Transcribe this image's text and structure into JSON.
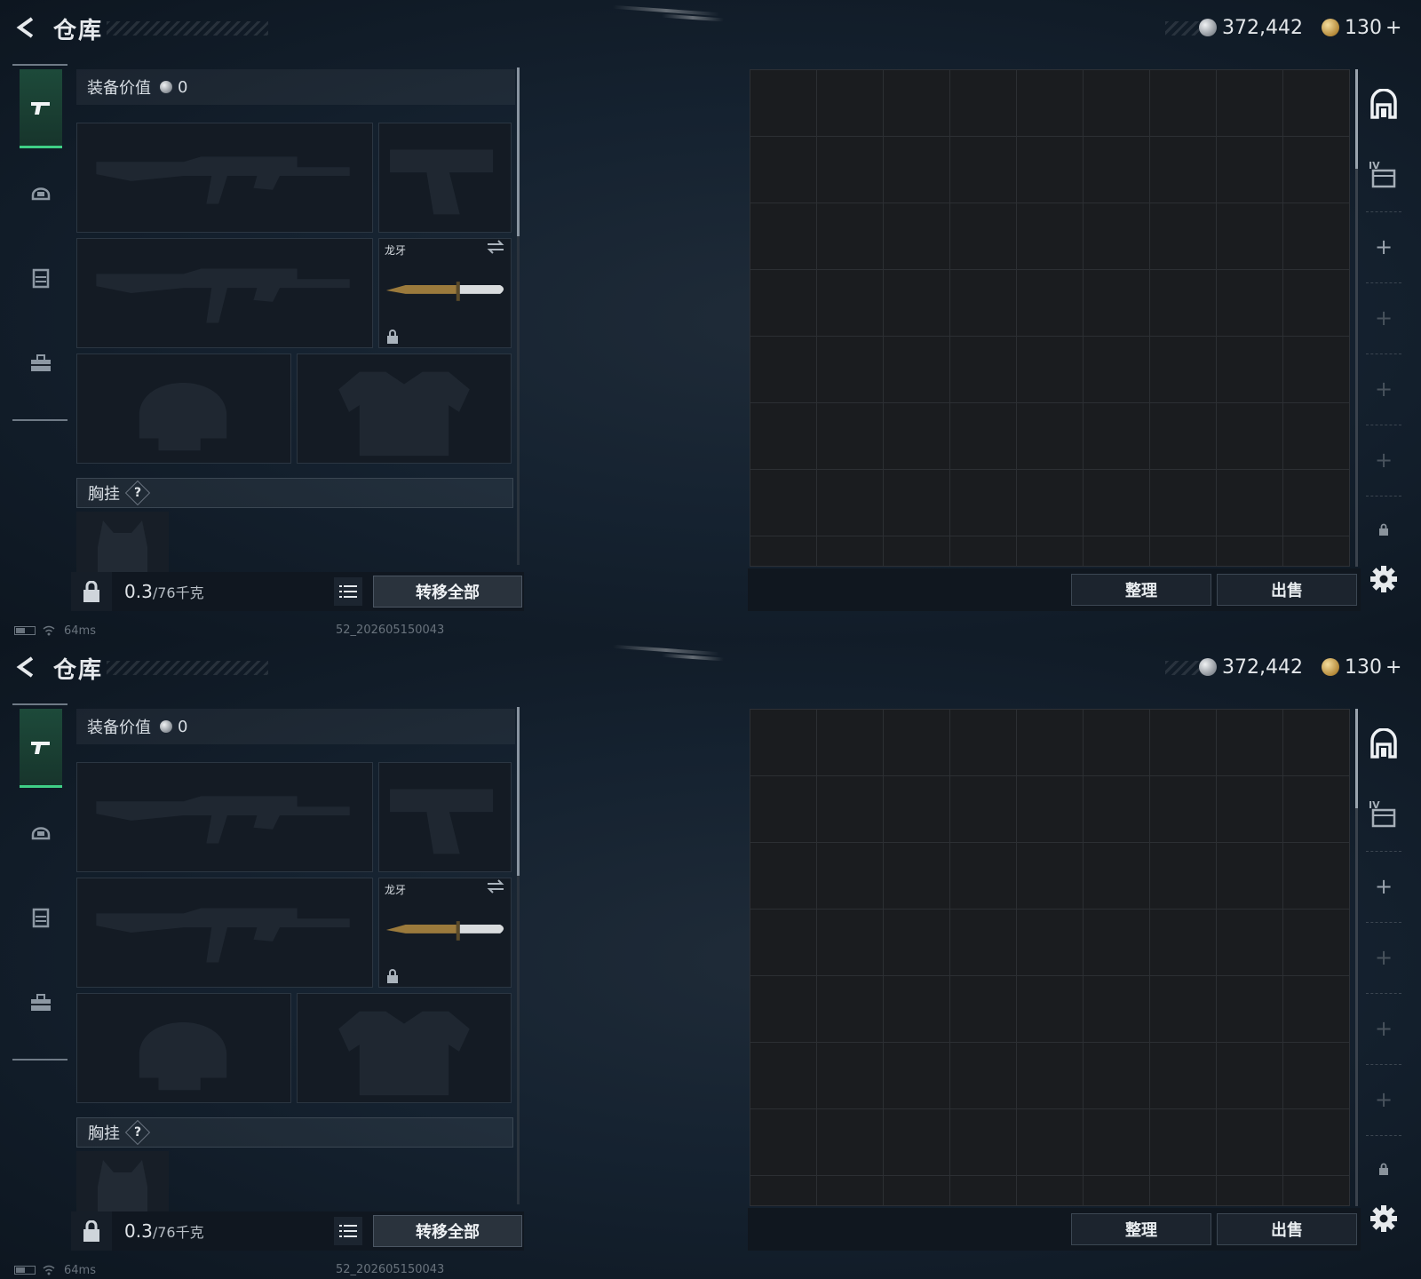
{
  "screens": [
    {
      "header": {
        "title": "仓库"
      },
      "currency": {
        "silver": "372,442",
        "gold": "130",
        "gold_add": "+"
      },
      "equipment": {
        "value_label": "装备价值",
        "value": "0",
        "knife_name": "龙牙",
        "chest_rig_label": "胸挂",
        "help": "?"
      },
      "weight": {
        "current": "0.3",
        "max": "/76",
        "unit": "千克"
      },
      "actions": {
        "transfer_all": "转移全部",
        "sort": "整理",
        "sell": "出售"
      },
      "status": {
        "ping": "64ms",
        "build": "52_202605150043"
      }
    },
    {
      "header": {
        "title": "仓库"
      },
      "currency": {
        "silver": "372,442",
        "gold": "130",
        "gold_add": "+"
      },
      "equipment": {
        "value_label": "装备价值",
        "value": "0",
        "knife_name": "龙牙",
        "chest_rig_label": "胸挂",
        "help": "?"
      },
      "weight": {
        "current": "0.3",
        "max": "/76",
        "unit": "千克"
      },
      "actions": {
        "transfer_all": "转移全部",
        "sort": "整理",
        "sell": "出售"
      },
      "status": {
        "ping": "64ms",
        "build": "52_202605150043"
      }
    }
  ],
  "icons": {
    "back": "back-arrow-icon",
    "rail": [
      "pistol-icon",
      "helmet-icon",
      "armor-vest-icon",
      "toolbox-icon"
    ],
    "stash_tabs": [
      "main-stash-icon",
      "stash-iv-icon"
    ],
    "settings": "gear-icon"
  },
  "colors": {
    "accent_green": "#3fcf86",
    "silver_coin": "#9aa0a7",
    "gold_coin": "#b58a3a"
  }
}
